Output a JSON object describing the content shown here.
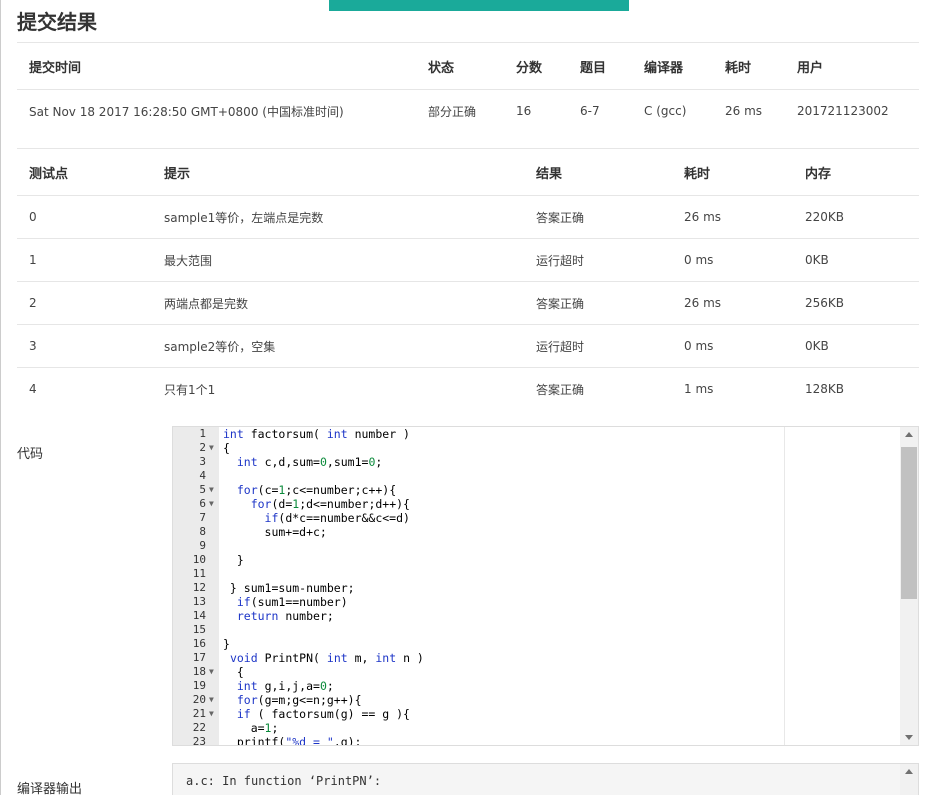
{
  "page": {
    "title": "提交结果"
  },
  "summary": {
    "headers": [
      "提交时间",
      "状态",
      "分数",
      "题目",
      "编译器",
      "耗时",
      "用户"
    ],
    "row": {
      "time": "Sat Nov 18 2017 16:28:50 GMT+0800 (中国标准时间)",
      "status": "部分正确",
      "score": "16",
      "problem": "6-7",
      "compiler": "C (gcc)",
      "elapsed": "26 ms",
      "user": "201721123002"
    }
  },
  "cases": {
    "headers": [
      "测试点",
      "提示",
      "结果",
      "耗时",
      "内存"
    ],
    "rows": [
      {
        "id": "0",
        "hint": "sample1等价，左端点是完数",
        "result": "答案正确",
        "time": "26 ms",
        "memory": "220KB"
      },
      {
        "id": "1",
        "hint": "最大范围",
        "result": "运行超时",
        "time": "0 ms",
        "memory": "0KB"
      },
      {
        "id": "2",
        "hint": "两端点都是完数",
        "result": "答案正确",
        "time": "26 ms",
        "memory": "256KB"
      },
      {
        "id": "3",
        "hint": "sample2等价，空集",
        "result": "运行超时",
        "time": "0 ms",
        "memory": "0KB"
      },
      {
        "id": "4",
        "hint": "只有1个1",
        "result": "答案正确",
        "time": "1 ms",
        "memory": "128KB"
      }
    ]
  },
  "code": {
    "label": "代码",
    "lines": [
      "int factorsum( int number )",
      "{",
      "  int c,d,sum=0,sum1=0;",
      "",
      "  for(c=1;c<=number;c++){",
      "    for(d=1;d<=number;d++){",
      "      if(d*c==number&&c<=d)",
      "      sum+=d+c;",
      "",
      "  }",
      "",
      " } sum1=sum-number;",
      "  if(sum1==number)",
      "  return number;",
      "",
      "}",
      " void PrintPN( int m, int n )",
      "  {",
      "  int g,i,j,a=0;",
      "  for(g=m;g<=n;g++){",
      "  if ( factorsum(g) == g ){",
      "    a=1;",
      "  printf(\"%d = \",g);"
    ],
    "folds": [
      2,
      5,
      6,
      18,
      20,
      21
    ]
  },
  "compiler_output": {
    "label": "编译器输出",
    "text": "a.c: In function ‘PrintPN’:"
  }
}
